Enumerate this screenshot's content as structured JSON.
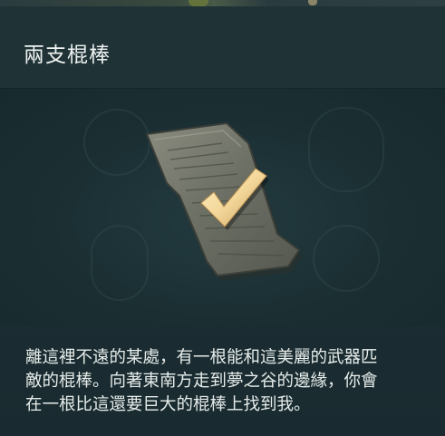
{
  "title": "兩支棍棒",
  "description_lines": [
    "離這裡不遠的某處，有一根能和這美麗的武器匹",
    "敵的棍棒。向著東南方走到夢之谷的邊緣，你會",
    "在一根比這還要巨大的棍棒上找到我。"
  ],
  "icons": {
    "item": "stone-tablet-icon",
    "status": "checkmark-icon"
  },
  "colors": {
    "checkmark": "#f3d79a",
    "panel_background": "#1c2f34",
    "text": "#e7ecea"
  }
}
